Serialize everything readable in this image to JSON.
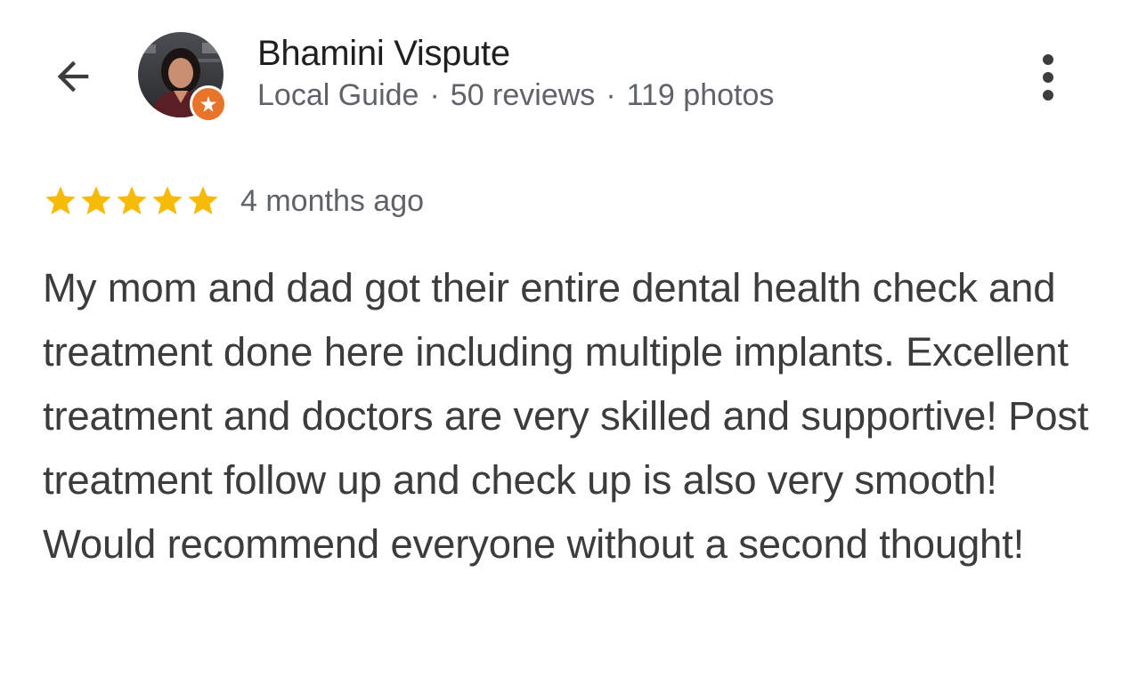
{
  "header": {
    "back_icon": "arrow-back-icon",
    "more_icon": "more-vert-icon"
  },
  "author": {
    "name": "Bhamini Vispute",
    "level": "Local Guide",
    "reviews": "50 reviews",
    "photos": "119 photos",
    "separator": "·",
    "badge_icon": "local-guide-star-icon",
    "badge_color": "#e8742a"
  },
  "review": {
    "rating": 5,
    "rating_max": 5,
    "star_color": "#f6bb06",
    "time": "4 months ago",
    "text": "My mom and dad got their entire dental health check and treatment done here including multiple implants. Excellent treatment and doctors are very skilled and supportive! Post treatment follow up and check up is also very smooth! Would recommend everyone without a second thought!"
  }
}
